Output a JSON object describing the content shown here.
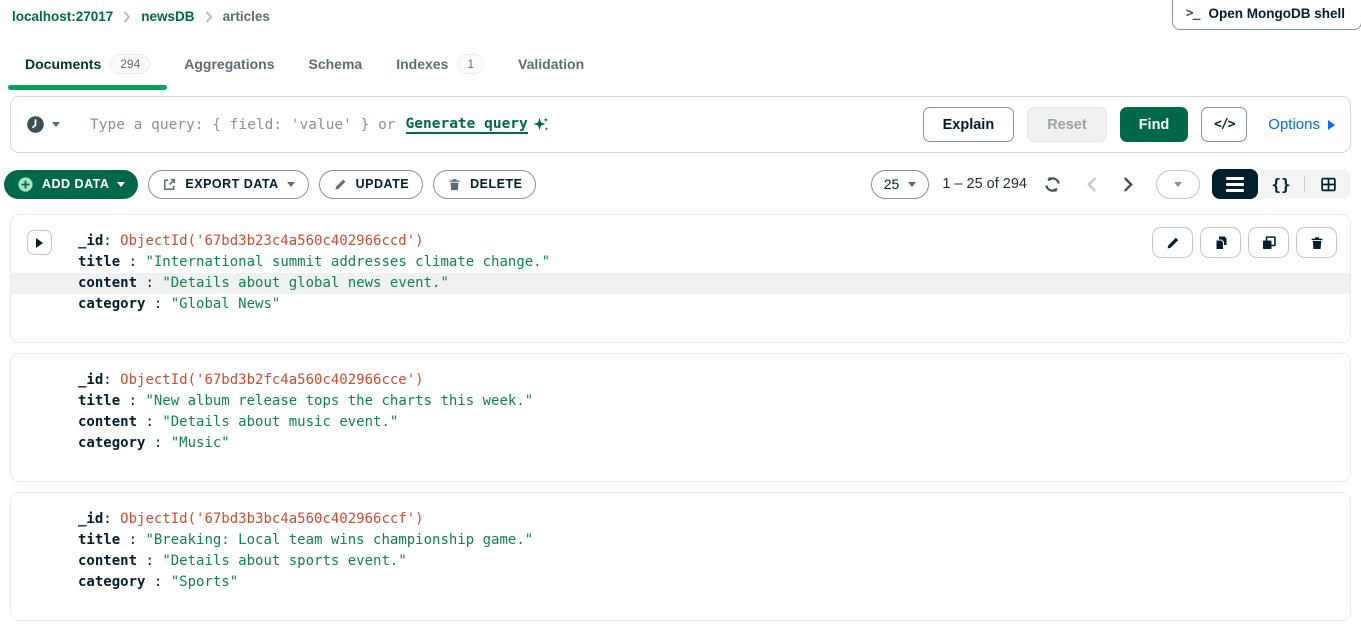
{
  "header": {
    "breadcrumb": {
      "items": [
        {
          "label": "localhost:27017"
        },
        {
          "label": "newsDB"
        },
        {
          "label": "articles"
        }
      ]
    },
    "shell_button_label": "Open MongoDB shell"
  },
  "tabs": [
    {
      "label": "Documents",
      "badge": "294"
    },
    {
      "label": "Aggregations"
    },
    {
      "label": "Schema"
    },
    {
      "label": "Indexes",
      "badge": "1"
    },
    {
      "label": "Validation"
    }
  ],
  "query_bar": {
    "placeholder_prefix": "Type a query: { field: 'value' } or",
    "generate_query_label": "Generate query",
    "explain_label": "Explain",
    "reset_label": "Reset",
    "find_label": "Find",
    "code_toggle_label": "</>",
    "options_label": "Options"
  },
  "toolbar": {
    "add_data_label": "ADD DATA",
    "export_data_label": "EXPORT DATA",
    "update_label": "UPDATE",
    "delete_label": "DELETE",
    "page_size": "25",
    "range_text": "1 – 25 of 294"
  },
  "icons": {
    "history": "clock-icon",
    "generate": "sparkle-icon",
    "views": [
      "list-view-icon",
      "json-view-icon",
      "table-view-icon"
    ],
    "doc_actions": [
      "edit-icon",
      "copy-icon",
      "clone-icon",
      "delete-icon"
    ]
  },
  "colors": {
    "brand_green": "#00684A",
    "tab_underline_green": "#00A35C",
    "link_blue": "#016BF8",
    "objectid_red": "#CA4C30",
    "string_green": "#12824D",
    "dark_navy": "#001E2B"
  },
  "documents": [
    {
      "fields": [
        {
          "key": "_id",
          "sep": ": ",
          "value": "ObjectId('67bd3b23c4a560c402966ccd')"
        },
        {
          "key": "title",
          "sep": " : ",
          "value": "\"International summit addresses climate change.\""
        },
        {
          "key": "content",
          "sep": " : ",
          "value": "\"Details about global news event.\""
        },
        {
          "key": "category",
          "sep": " : ",
          "value": "\"Global News\""
        }
      ]
    },
    {
      "fields": [
        {
          "key": "_id",
          "sep": ": ",
          "value": "ObjectId('67bd3b2fc4a560c402966cce')"
        },
        {
          "key": "title",
          "sep": " : ",
          "value": "\"New album release tops the charts this week.\""
        },
        {
          "key": "content",
          "sep": " : ",
          "value": "\"Details about music event.\""
        },
        {
          "key": "category",
          "sep": " : ",
          "value": "\"Music\""
        }
      ]
    },
    {
      "fields": [
        {
          "key": "_id",
          "sep": ": ",
          "value": "ObjectId('67bd3b3bc4a560c402966ccf')"
        },
        {
          "key": "title",
          "sep": " : ",
          "value": "\"Breaking: Local team wins championship game.\""
        },
        {
          "key": "content",
          "sep": " : ",
          "value": "\"Details about sports event.\""
        },
        {
          "key": "category",
          "sep": " : ",
          "value": "\"Sports\""
        }
      ]
    }
  ]
}
